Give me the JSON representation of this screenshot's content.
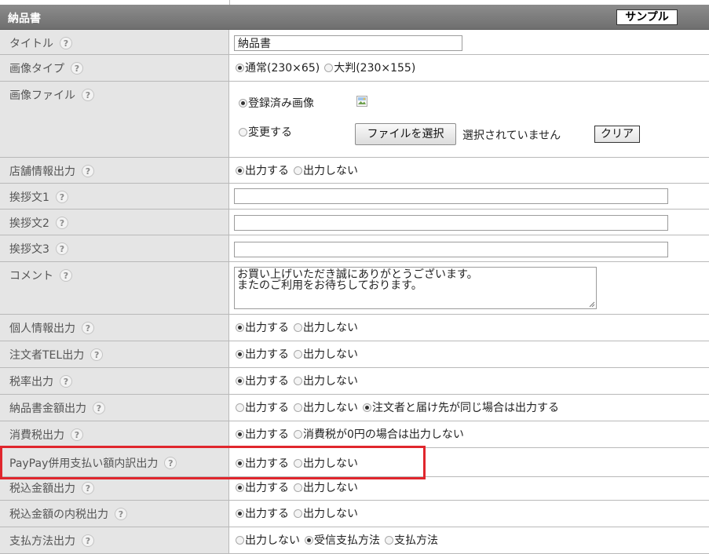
{
  "header": {
    "title": "納品書",
    "sample_button": "サンプル"
  },
  "help_label": "?",
  "colors": {
    "highlight": "#e0262d",
    "header_bg": "#7a7a7a",
    "label_bg": "#e5e5e5"
  },
  "rows": {
    "title": {
      "label": "タイトル",
      "value": "納品書"
    },
    "image_type": {
      "label": "画像タイプ",
      "options": [
        "通常(230×65)",
        "大判(230×155)"
      ],
      "selected": 0
    },
    "image_file": {
      "label": "画像ファイル",
      "option_registered": "登録済み画像",
      "option_change": "変更する",
      "broken_image_icon": "broken-image-icon",
      "file_button": "ファイルを選択",
      "no_file_text": "選択されていません",
      "clear_button": "クリア"
    },
    "shop_info": {
      "label": "店舗情報出力",
      "options": [
        "出力する",
        "出力しない"
      ],
      "selected": 0
    },
    "greeting1": {
      "label": "挨拶文1",
      "value": ""
    },
    "greeting2": {
      "label": "挨拶文2",
      "value": ""
    },
    "greeting3": {
      "label": "挨拶文3",
      "value": ""
    },
    "comment": {
      "label": "コメント",
      "value": "お買い上げいただき誠にありがとうございます。\nまたのご利用をお待ちしております。"
    },
    "personal_info": {
      "label": "個人情報出力",
      "options": [
        "出力する",
        "出力しない"
      ],
      "selected": 0
    },
    "orderer_tel": {
      "label": "注文者TEL出力",
      "options": [
        "出力する",
        "出力しない"
      ],
      "selected": 0
    },
    "tax_rate": {
      "label": "税率出力",
      "options": [
        "出力する",
        "出力しない"
      ],
      "selected": 0
    },
    "invoice_amount": {
      "label": "納品書金額出力",
      "options": [
        "出力する",
        "出力しない",
        "注文者と届け先が同じ場合は出力する"
      ],
      "selected": 2
    },
    "consumption_tax": {
      "label": "消費税出力",
      "options": [
        "出力する",
        "消費税が0円の場合は出力しない"
      ],
      "selected": 0
    },
    "paypay_breakdown": {
      "label": "PayPay併用支払い額内訳出力",
      "options": [
        "出力する",
        "出力しない"
      ],
      "selected": 0
    },
    "tax_included_amount": {
      "label": "税込金額出力",
      "options": [
        "出力する",
        "出力しない"
      ],
      "selected": 0
    },
    "tax_included_internal": {
      "label": "税込金額の内税出力",
      "options": [
        "出力する",
        "出力しない"
      ],
      "selected": 0
    },
    "payment_method": {
      "label": "支払方法出力",
      "options": [
        "出力しない",
        "受信支払方法",
        "支払方法"
      ],
      "selected": 1
    }
  }
}
